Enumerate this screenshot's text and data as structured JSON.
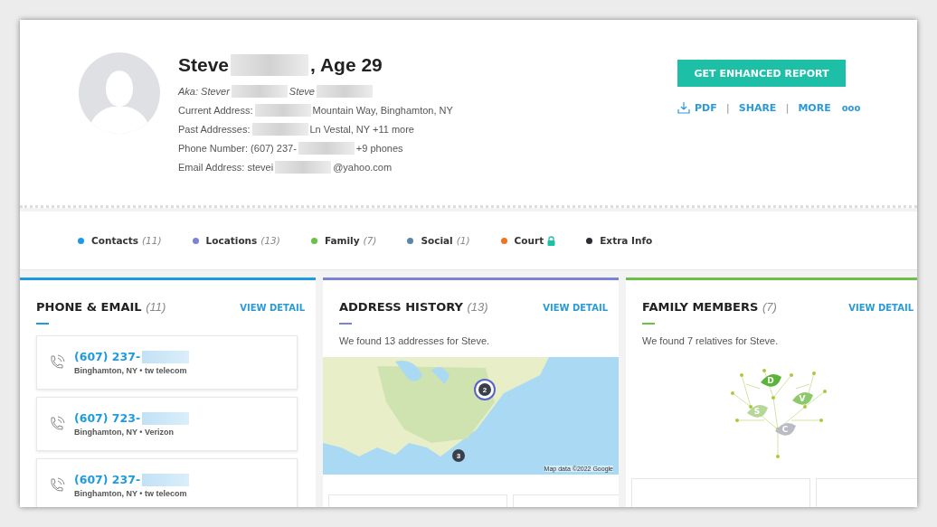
{
  "profile": {
    "name_parts": [
      {
        "kind": "text",
        "text": "Steve"
      },
      {
        "kind": "blur"
      },
      {
        "kind": "text",
        "text": ", Age 29"
      }
    ],
    "details": [
      {
        "kind": "aka",
        "parts": [
          {
            "kind": "text",
            "text": "Aka: Stever"
          },
          {
            "kind": "blur"
          },
          {
            "kind": "text",
            "text": "Steve"
          },
          {
            "kind": "blur"
          }
        ]
      },
      {
        "kind": "plain",
        "parts": [
          {
            "kind": "text",
            "text": "Current Address:"
          },
          {
            "kind": "blur"
          },
          {
            "kind": "text",
            "text": "Mountain Way, Binghamton, NY"
          }
        ]
      },
      {
        "kind": "plain",
        "parts": [
          {
            "kind": "text",
            "text": "Past Addresses:"
          },
          {
            "kind": "blur"
          },
          {
            "kind": "text",
            "text": "Ln Vestal, NY +11 more"
          }
        ]
      },
      {
        "kind": "plain",
        "parts": [
          {
            "kind": "text",
            "text": "Phone Number: (607) 237-"
          },
          {
            "kind": "blur"
          },
          {
            "kind": "text",
            "text": "+9 phones"
          }
        ]
      },
      {
        "kind": "plain",
        "parts": [
          {
            "kind": "text",
            "text": "Email Address: stevei"
          },
          {
            "kind": "blur"
          },
          {
            "kind": "text",
            "text": "@yahoo.com"
          }
        ]
      }
    ]
  },
  "actions": {
    "primary": "GET ENHANCED REPORT",
    "links": [
      {
        "label": "PDF",
        "kind": "download"
      },
      {
        "label": "SHARE",
        "kind": "plain"
      },
      {
        "label": "MORE",
        "kind": "plain"
      }
    ],
    "more_icon": "ooo",
    "separator": "|"
  },
  "categories": [
    {
      "label": "Contacts",
      "count": "(11)",
      "color": "#1e9be0",
      "locked": false
    },
    {
      "label": "Locations",
      "count": "(13)",
      "color": "#7b83d6",
      "locked": false
    },
    {
      "label": "Family",
      "count": "(7)",
      "color": "#6cc04a",
      "locked": false
    },
    {
      "label": "Social",
      "count": "(1)",
      "color": "#5b86a8",
      "locked": false
    },
    {
      "label": "Court",
      "color": "#f0731e",
      "locked": true
    },
    {
      "label": "Extra Info",
      "color": "#2b2d33",
      "locked": false
    }
  ],
  "cards": [
    {
      "kind": "phones",
      "title": "PHONE & EMAIL",
      "count": "(11)",
      "color": "#1e9be0",
      "link": "VIEW DETAIL",
      "entries": [
        {
          "number": "(607) 237-",
          "detail": "Binghamton, NY • tw telecom"
        },
        {
          "number": "(607) 723-",
          "detail": "Binghamton, NY • Verizon"
        },
        {
          "number": "(607) 237-",
          "detail": "Binghamton, NY • tw telecom"
        }
      ]
    },
    {
      "kind": "map",
      "title": "ADDRESS HISTORY",
      "count": "(13)",
      "color": "#7b83d6",
      "link": "VIEW DETAIL",
      "summary": "We found 13 addresses for Steve.",
      "markers": [
        "2",
        "3"
      ],
      "attribution": "Map data ©2022 Google"
    },
    {
      "kind": "tree",
      "title": "FAMILY MEMBERS",
      "count": "(7)",
      "color": "#6cc04a",
      "link": "VIEW DETAIL",
      "summary": "We found 7 relatives for Steve.",
      "leaves": [
        "D",
        "V",
        "S",
        "C"
      ]
    }
  ]
}
